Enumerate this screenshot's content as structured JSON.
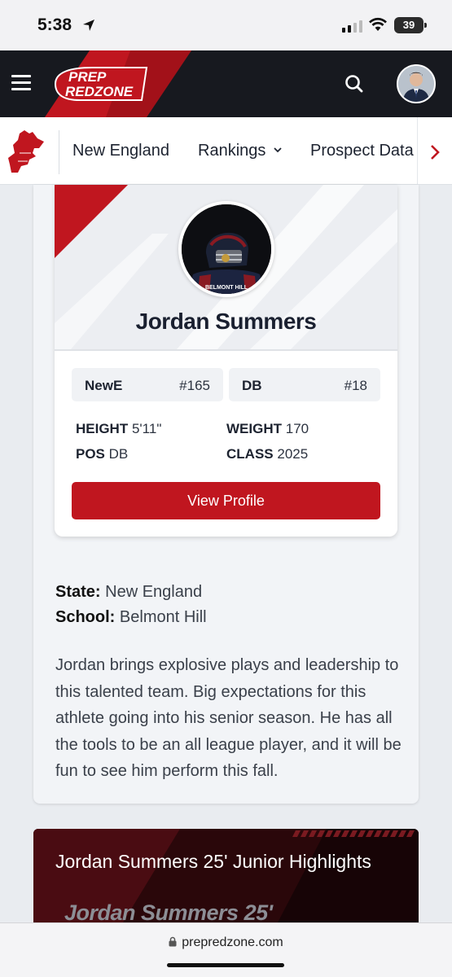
{
  "status_bar": {
    "time": "5:38",
    "battery": "39"
  },
  "header": {
    "logo_top": "PREP",
    "logo_bottom": "REDZONE"
  },
  "subnav": {
    "items": [
      {
        "label": "New England"
      },
      {
        "label": "Rankings"
      },
      {
        "label": "Prospect Data"
      }
    ]
  },
  "profile": {
    "name": "Jordan Summers",
    "photo_caption": "BELMONT HILL",
    "ranks": [
      {
        "label": "NewE",
        "value": "#165"
      },
      {
        "label": "DB",
        "value": "#18"
      }
    ],
    "stats": {
      "height_label": "HEIGHT",
      "height_value": "5'11\"",
      "weight_label": "WEIGHT",
      "weight_value": "170",
      "pos_label": "POS",
      "pos_value": "DB",
      "class_label": "CLASS",
      "class_value": "2025"
    },
    "button_label": "View Profile"
  },
  "info": {
    "state_label": "State:",
    "state_value": "New England",
    "school_label": "School:",
    "school_value": "Belmont Hill",
    "bio": "Jordan brings explosive plays and leadership to this talented team.  Big expectations for this athlete going into his senior season.  He has all the tools to be an all league player, and it will be fun to see him perform this fall."
  },
  "video": {
    "title": "Jordan Summers 25' Junior Highlights",
    "overlay_text": "Jordan Summers 25'"
  },
  "url_bar": {
    "domain": "prepredzone.com"
  },
  "colors": {
    "brand_red": "#c0161f",
    "header_dark": "#17191f"
  }
}
